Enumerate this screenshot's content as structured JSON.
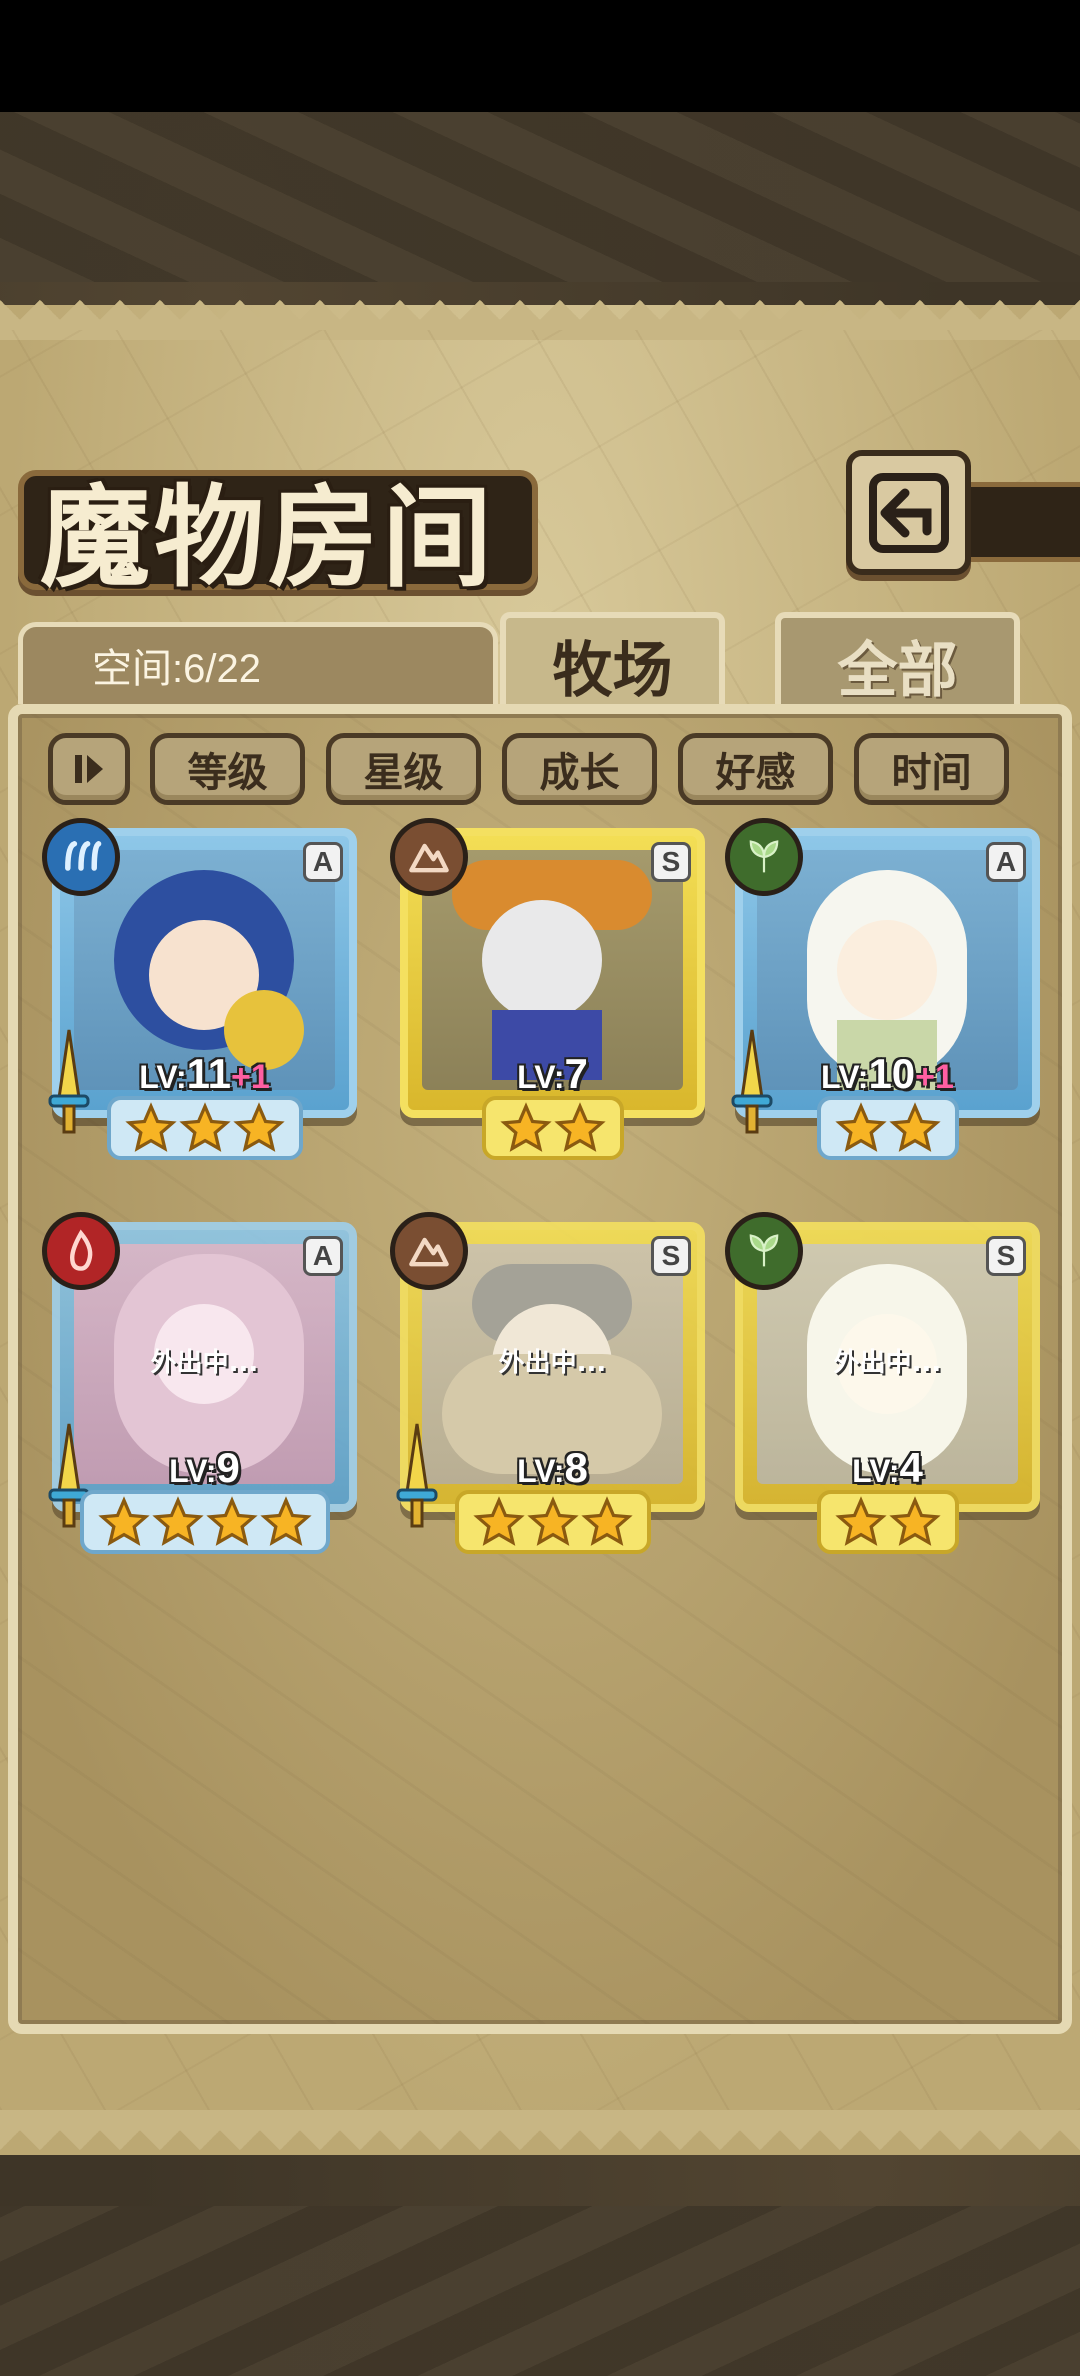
{
  "title": "魔物房间",
  "space": {
    "label": "空间:6/22"
  },
  "tabs": [
    {
      "label": "牧场",
      "active": true
    },
    {
      "label": "全部",
      "active": false
    }
  ],
  "filters": [
    {
      "label": "等级"
    },
    {
      "label": "星级"
    },
    {
      "label": "成长"
    },
    {
      "label": "好感"
    },
    {
      "label": "时间"
    }
  ],
  "away_label": "外出中...",
  "monsters": [
    {
      "level_prefix": "LV:",
      "level": "11",
      "bonus": "+1",
      "rarity": "A",
      "element": "water-icon",
      "stars": 3,
      "frame": "blue",
      "away": false,
      "equipped": true
    },
    {
      "level_prefix": "LV:",
      "level": "7",
      "bonus": "",
      "rarity": "S",
      "element": "earth-icon",
      "stars": 2,
      "frame": "gold",
      "away": false,
      "equipped": false
    },
    {
      "level_prefix": "LV:",
      "level": "10",
      "bonus": "+1",
      "rarity": "A",
      "element": "leaf-icon",
      "stars": 2,
      "frame": "blue",
      "away": false,
      "equipped": true
    },
    {
      "level_prefix": "LV:",
      "level": "9",
      "bonus": "",
      "rarity": "A",
      "element": "fire-icon",
      "stars": 4,
      "frame": "blue",
      "away": true,
      "equipped": true
    },
    {
      "level_prefix": "LV:",
      "level": "8",
      "bonus": "",
      "rarity": "S",
      "element": "earth-icon",
      "stars": 3,
      "frame": "gold",
      "away": true,
      "equipped": true
    },
    {
      "level_prefix": "LV:",
      "level": "4",
      "bonus": "",
      "rarity": "S",
      "element": "leaf-icon",
      "stars": 2,
      "frame": "gold",
      "away": true,
      "equipped": false
    }
  ],
  "colors": {
    "blue_frame": "#9fd0ec",
    "gold_frame": "#f4e060",
    "parchment": "#c8b684",
    "bonus": "#ff5fa2"
  }
}
